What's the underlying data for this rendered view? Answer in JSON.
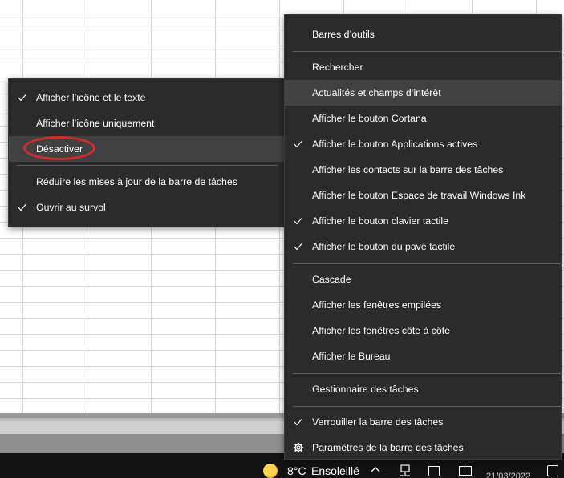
{
  "left_menu": {
    "items": [
      {
        "label": "Afficher l’icône et le texte",
        "checked": true
      },
      {
        "label": "Afficher l’icône uniquement",
        "checked": false
      },
      {
        "label": "Désactiver",
        "checked": false,
        "highlighted": true
      },
      {
        "label": "Réduire les mises à jour de la barre de tâches",
        "checked": false
      },
      {
        "label": "Ouvrir au survol",
        "checked": true
      }
    ]
  },
  "right_menu": {
    "items": [
      {
        "label": "Barres d’outils",
        "checked": false
      },
      {
        "label": "Rechercher",
        "checked": false
      },
      {
        "label": "Actualités et champs d’intérêt",
        "checked": false,
        "highlighted": true
      },
      {
        "label": "Afficher le bouton Cortana",
        "checked": false
      },
      {
        "label": "Afficher le bouton Applications actives",
        "checked": true
      },
      {
        "label": "Afficher les contacts sur la barre des tâches",
        "checked": false
      },
      {
        "label": "Afficher le bouton Espace de travail Windows Ink",
        "checked": false
      },
      {
        "label": "Afficher le bouton clavier tactile",
        "checked": true
      },
      {
        "label": "Afficher le bouton du pavé tactile",
        "checked": true
      },
      {
        "label": "Cascade",
        "checked": false
      },
      {
        "label": "Afficher les fenêtres empilées",
        "checked": false
      },
      {
        "label": "Afficher les fenêtres côte à côte",
        "checked": false
      },
      {
        "label": "Afficher le Bureau",
        "checked": false
      },
      {
        "label": "Gestionnaire des tâches",
        "checked": false
      },
      {
        "label": "Verrouiller la barre des tâches",
        "checked": true
      },
      {
        "label": "Paramètres de la barre des tâches",
        "checked": false,
        "icon": "gear-icon"
      }
    ]
  },
  "taskbar": {
    "temperature": "8°C",
    "weather": "Ensoleillé",
    "date": "21/03/2022"
  },
  "colors": {
    "menu_bg": "#2b2b2b",
    "menu_hover": "#414141",
    "annotation_red": "#d7282c",
    "taskbar_bg": "#121212"
  }
}
